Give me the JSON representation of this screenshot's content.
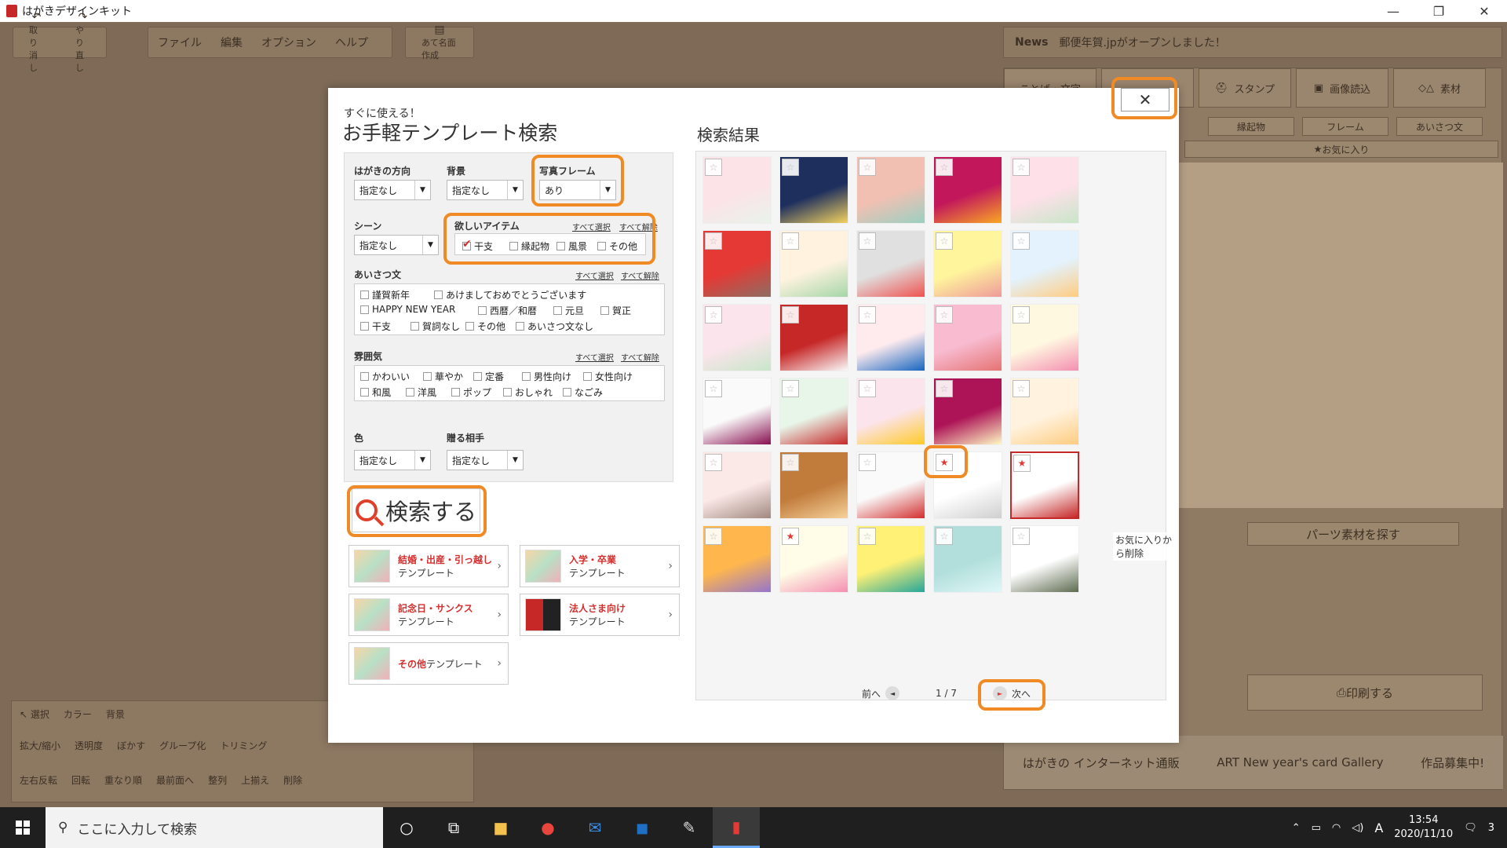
{
  "app": {
    "title": "はがきデザインキット",
    "win_min": "—",
    "win_max": "❐",
    "win_close": "✕"
  },
  "toolbar": {
    "undo": "取り消し",
    "redo": "やり直し",
    "file": "ファイル",
    "edit": "編集",
    "option": "オプション",
    "help": "ヘルプ",
    "address": "あて名面作成"
  },
  "news": {
    "label": "News",
    "text": "郵便年賀.jpがオープンしました！"
  },
  "right_panel": {
    "tabs": [
      "ことば・文字",
      "",
      "スタンプ",
      "画像読込",
      "素材"
    ],
    "subtabs": [
      "縁起物",
      "フレーム",
      "あいさつ文"
    ],
    "favorites": "お気に入り",
    "parts_search": "パーツ素材を探す",
    "print": "印刷する",
    "banner_left": "はがきの インターネット通販",
    "banner_right": "ART New year's card Gallery",
    "banner_badge": "作品募集中!"
  },
  "bottom_tools": {
    "select": "選択",
    "color": "カラー",
    "background": "背景",
    "zoom": "拡大/縮小",
    "opacity": "透明度",
    "blur": "ぼかす",
    "group": "グループ化",
    "trimming": "トリミング",
    "flip": "左右反転",
    "rotate": "回転",
    "order": "重なり順",
    "front": "最前面へ",
    "align": "整列",
    "align_val": "上揃え",
    "delete": "削除"
  },
  "dialog": {
    "subtitle": "すぐに使える！",
    "title": "お手軽テンプレート検索",
    "results_title": "検索結果",
    "close": "✕",
    "filters": {
      "direction_label": "はがきの方向",
      "direction_value": "指定なし",
      "background_label": "背景",
      "background_value": "指定なし",
      "frame_label": "写真フレーム",
      "frame_value": "あり",
      "scene_label": "シーン",
      "scene_value": "指定なし",
      "items_label": "欲しいアイテム",
      "select_all": "すべて選択",
      "clear_all": "すべて解除",
      "items": [
        {
          "label": "干支",
          "checked": true
        },
        {
          "label": "縁起物",
          "checked": false
        },
        {
          "label": "風景",
          "checked": false
        },
        {
          "label": "その他",
          "checked": false
        }
      ],
      "greeting_label": "あいさつ文",
      "greetings": [
        "謹賀新年",
        "あけましておめでとうございます",
        "HAPPY NEW YEAR",
        "西暦／和暦",
        "元旦",
        "賀正",
        "干支",
        "賀詞なし",
        "その他",
        "あいさつ文なし"
      ],
      "mood_label": "雰囲気",
      "moods": [
        "かわいい",
        "華やか",
        "定番",
        "男性向け",
        "女性向け",
        "和風",
        "洋風",
        "ポップ",
        "おしゃれ",
        "なごみ"
      ],
      "color_label": "色",
      "color_value": "指定なし",
      "recipient_label": "贈る相手",
      "recipient_value": "指定なし"
    },
    "search_button": "検索する",
    "categories": [
      {
        "t1": "結婚・出産・引っ越し",
        "t2": "テンプレート"
      },
      {
        "t1": "入学・卒業",
        "t2": "テンプレート"
      },
      {
        "t1": "記念日・サンクス",
        "t2": "テンプレート"
      },
      {
        "t1": "法人さま向け",
        "t2": "テンプレート"
      },
      {
        "t1": "その他",
        "t2": "テンプレート"
      }
    ],
    "tooltip": "お気に入りから削除",
    "pager": {
      "prev": "前へ",
      "page": "1 / 7",
      "next": "次へ"
    },
    "star_states": [
      0,
      0,
      0,
      0,
      0,
      0,
      0,
      0,
      0,
      0,
      0,
      0,
      0,
      0,
      0,
      0,
      0,
      0,
      0,
      0,
      0,
      0,
      0,
      1,
      1,
      0,
      1,
      0,
      0,
      0
    ]
  },
  "taskbar": {
    "search_placeholder": "ここに入力して検索",
    "time": "13:54",
    "date": "2020/11/10",
    "ime": "A",
    "notif": "3"
  },
  "colors": {
    "highlight": "#f08a24",
    "accent_red": "#d32f2f"
  }
}
